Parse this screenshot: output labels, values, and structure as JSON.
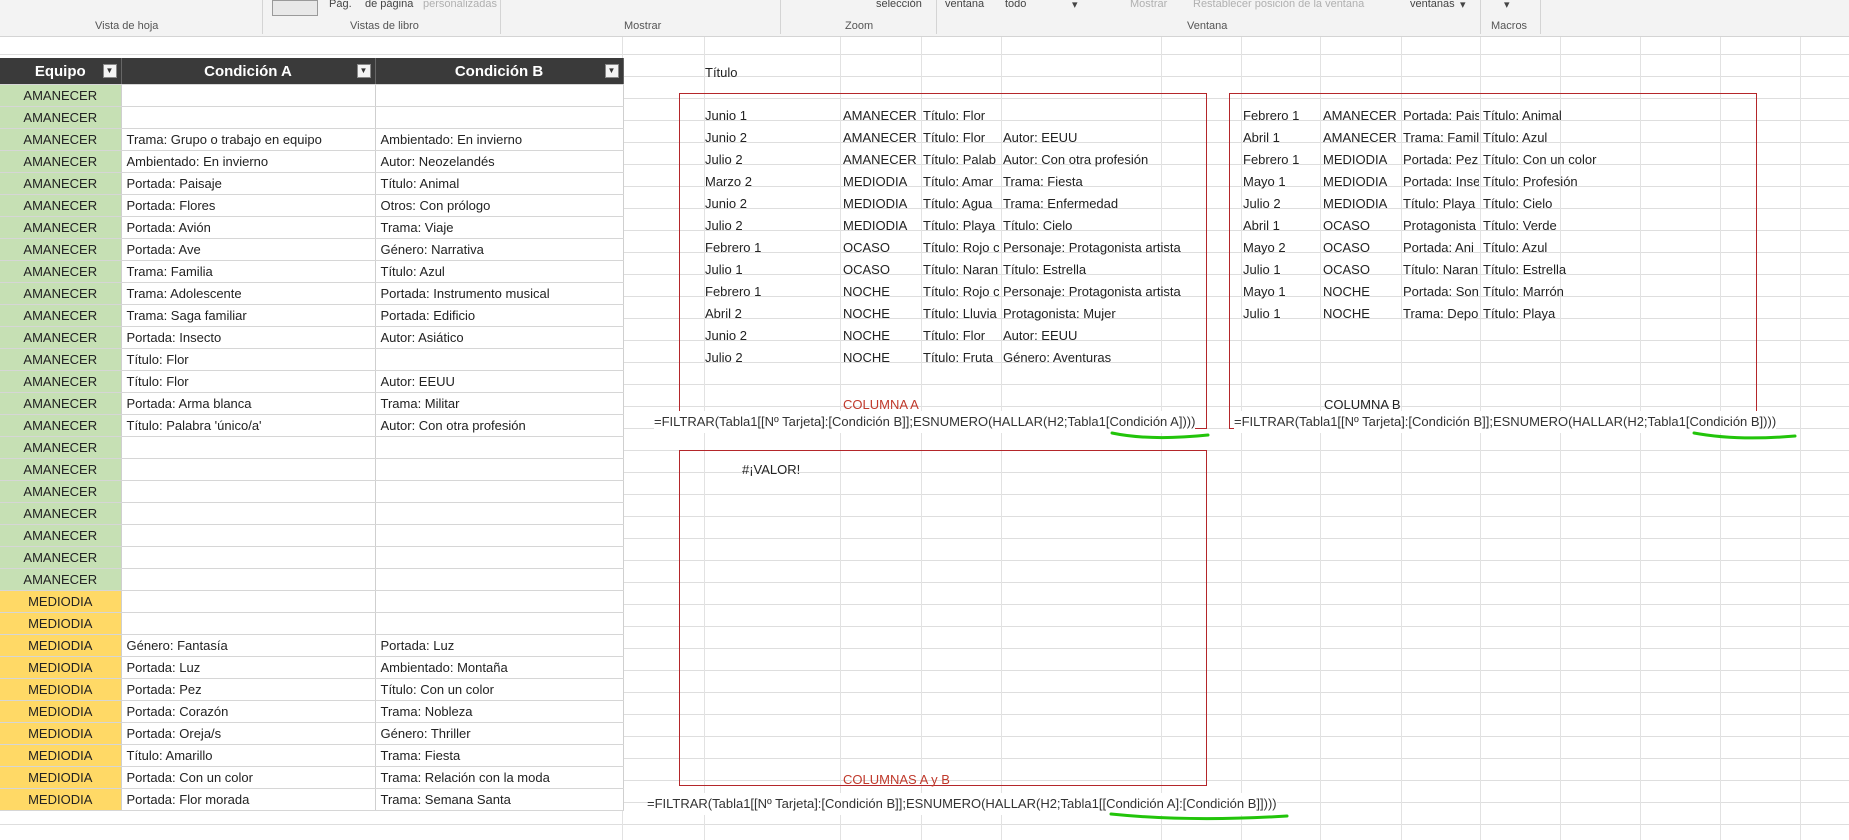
{
  "ribbon": {
    "texts": [
      "Pág.",
      "de página",
      "personalizadas",
      "selección",
      "ventana",
      "todo",
      "Mostrar",
      "Restablecer posición de la ventana",
      "ventanas"
    ],
    "groups": [
      "Vista de hoja",
      "Vistas de libro",
      "Mostrar",
      "Zoom",
      "Ventana",
      "Macros"
    ]
  },
  "table": {
    "headers": [
      "Equipo",
      "Condición A",
      "Condición B"
    ],
    "rows": [
      [
        "AMANECER",
        "",
        ""
      ],
      [
        "AMANECER",
        "",
        ""
      ],
      [
        "AMANECER",
        "Trama: Grupo o trabajo en equipo",
        "Ambientado: En invierno"
      ],
      [
        "AMANECER",
        "Ambientado: En invierno",
        "Autor: Neozelandés"
      ],
      [
        "AMANECER",
        "Portada: Paisaje",
        "Título: Animal"
      ],
      [
        "AMANECER",
        "Portada: Flores",
        "Otros: Con prólogo"
      ],
      [
        "AMANECER",
        "Portada: Avión",
        "Trama: Viaje"
      ],
      [
        "AMANECER",
        "Portada: Ave",
        "Género: Narrativa"
      ],
      [
        "AMANECER",
        "Trama: Familia",
        "Título: Azul"
      ],
      [
        "AMANECER",
        "Trama: Adolescente",
        "Portada: Instrumento musical"
      ],
      [
        "AMANECER",
        "Trama: Saga familiar",
        "Portada: Edificio"
      ],
      [
        "AMANECER",
        "Portada: Insecto",
        "Autor: Asiático"
      ],
      [
        "AMANECER",
        "Título: Flor",
        ""
      ],
      [
        "AMANECER",
        "Título: Flor",
        "Autor: EEUU"
      ],
      [
        "AMANECER",
        "Portada: Arma blanca",
        "Trama: Militar"
      ],
      [
        "AMANECER",
        "Título: Palabra 'único/a'",
        "Autor: Con otra profesión"
      ],
      [
        "AMANECER",
        "",
        ""
      ],
      [
        "AMANECER",
        "",
        ""
      ],
      [
        "AMANECER",
        "",
        ""
      ],
      [
        "AMANECER",
        "",
        ""
      ],
      [
        "AMANECER",
        "",
        ""
      ],
      [
        "AMANECER",
        "",
        ""
      ],
      [
        "AMANECER",
        "",
        ""
      ],
      [
        "MEDIODIA",
        "",
        ""
      ],
      [
        "MEDIODIA",
        "",
        ""
      ],
      [
        "MEDIODIA",
        "Género: Fantasía",
        "Portada: Luz"
      ],
      [
        "MEDIODIA",
        "Portada: Luz",
        "Ambientado: Montaña"
      ],
      [
        "MEDIODIA",
        "Portada: Pez",
        "Título: Con un color"
      ],
      [
        "MEDIODIA",
        "Portada: Corazón",
        "Trama: Nobleza"
      ],
      [
        "MEDIODIA",
        "Portada: Oreja/s",
        "Género: Thriller"
      ],
      [
        "MEDIODIA",
        "Título: Amarillo",
        "Trama: Fiesta"
      ],
      [
        "MEDIODIA",
        "Portada: Con un color",
        "Trama: Relación con la moda"
      ],
      [
        "MEDIODIA",
        "Portada: Flor morada",
        "Trama: Semana Santa"
      ]
    ]
  },
  "right": {
    "titulo": "Título",
    "resultsA": [
      [
        "Junio 1",
        "AMANECER",
        "Título: Flor",
        ""
      ],
      [
        "Junio 2",
        "AMANECER",
        "Título: Flor",
        "Autor: EEUU"
      ],
      [
        "Julio 2",
        "AMANECER",
        "Título: Palab",
        "Autor: Con otra profesión"
      ],
      [
        "Marzo 2",
        "MEDIODIA",
        "Título: Amar",
        "Trama: Fiesta"
      ],
      [
        "Junio 2",
        "MEDIODIA",
        "Título: Agua",
        "Trama: Enfermedad"
      ],
      [
        "Julio 2",
        "MEDIODIA",
        "Título: Playa",
        "Título: Cielo"
      ],
      [
        "Febrero 1",
        "OCASO",
        "Título: Rojo c",
        "Personaje: Protagonista artista"
      ],
      [
        "Julio 1",
        "OCASO",
        "Título: Naran",
        "Título: Estrella"
      ],
      [
        "Febrero 1",
        "NOCHE",
        "Título: Rojo c",
        "Personaje: Protagonista artista"
      ],
      [
        "Abril 2",
        "NOCHE",
        "Título: Lluvia",
        "Protagonista: Mujer"
      ],
      [
        "Junio 2",
        "NOCHE",
        "Título: Flor",
        "Autor: EEUU"
      ],
      [
        "Julio 2",
        "NOCHE",
        "Título: Fruta",
        "Género: Aventuras"
      ]
    ],
    "resultsB": [
      [
        "Febrero 1",
        "AMANECER",
        "Portada: Pais",
        "Título: Animal"
      ],
      [
        "Abril 1",
        "AMANECER",
        "Trama: Famil",
        "Título: Azul"
      ],
      [
        "Febrero 1",
        "MEDIODIA",
        "Portada: Pez",
        "Título: Con un color"
      ],
      [
        "Mayo 1",
        "MEDIODIA",
        "Portada: Inse",
        "Título: Profesión"
      ],
      [
        "Julio 2",
        "MEDIODIA",
        "Título: Playa",
        "Título: Cielo"
      ],
      [
        "Abril 1",
        "OCASO",
        "Protagonista",
        "Título: Verde"
      ],
      [
        "Mayo 2",
        "OCASO",
        "Portada: Ani",
        "Título: Azul"
      ],
      [
        "Julio 1",
        "OCASO",
        "Título: Naran",
        "Título: Estrella"
      ],
      [
        "Mayo 1",
        "NOCHE",
        "Portada: Son",
        "Título: Marrón"
      ],
      [
        "Julio 1",
        "NOCHE",
        "Trama: Depo",
        "Título: Playa"
      ]
    ],
    "labelA": "COLUMNA A",
    "labelB": "COLUMNA B",
    "labelAB": "COLUMNAS A y B",
    "formulaA": "=FILTRAR(Tabla1[[Nº Tarjeta]:[Condición B]];ESNUMERO(HALLAR(H2;Tabla1[Condición A])))",
    "formulaB": "=FILTRAR(Tabla1[[Nº Tarjeta]:[Condición B]];ESNUMERO(HALLAR(H2;Tabla1[Condición B])))",
    "formulaAB": "=FILTRAR(Tabla1[[Nº Tarjeta]:[Condición B]];ESNUMERO(HALLAR(H2;Tabla1[[Condición A]:[Condición B]])))",
    "error": "#¡VALOR!"
  },
  "colors": {
    "amanecer": "#c6e0b4",
    "mediodia": "#ffd966",
    "box": "#b4262a",
    "label": "#c0392b",
    "highlight": "#22c40a"
  }
}
